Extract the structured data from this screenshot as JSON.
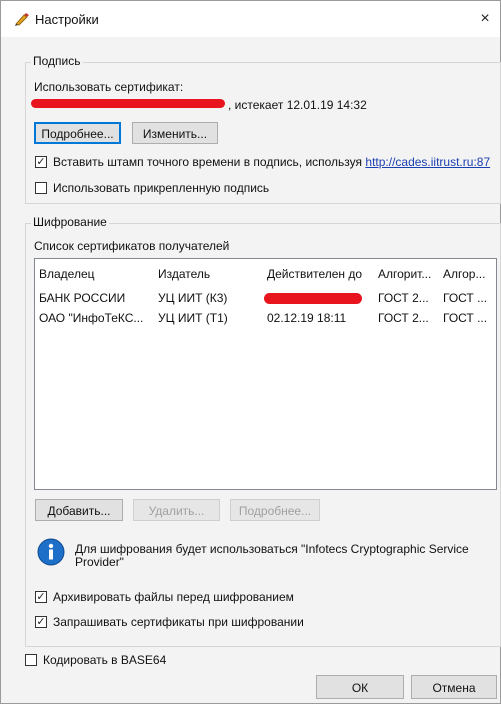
{
  "window": {
    "title": "Настройки",
    "close_glyph": "×"
  },
  "signature": {
    "group_label": "Подпись",
    "use_cert_label": "Использовать сертификат:",
    "cert_expiry": ", истекает 12.01.19 14:32",
    "details_button": "Подробнее...",
    "change_button": "Изменить...",
    "timestamp_checkbox": {
      "checked": true,
      "label": "Вставить штамп точного времени в подпись, используя",
      "link": "http://cades.iitrust.ru:87"
    },
    "attached_sig_checkbox": {
      "checked": false,
      "label": "Использовать прикрепленную подпись"
    }
  },
  "encryption": {
    "group_label": "Шифрование",
    "recipients_label": "Список сертификатов получателей",
    "columns": [
      "Владелец",
      "Издатель",
      "Действителен до",
      "Алгорит...",
      "Алгор..."
    ],
    "rows": [
      {
        "owner": "БАНК РОССИИ",
        "issuer": "УЦ ИИТ (К3)",
        "valid_to": "",
        "alg1": "ГОСТ 2...",
        "alg2": "ГОСТ ..."
      },
      {
        "owner": "ОАО \"ИнфоТеКС...",
        "issuer": "УЦ ИИТ (Т1)",
        "valid_to": "02.12.19 18:11",
        "alg1": "ГОСТ 2...",
        "alg2": "ГОСТ ..."
      }
    ],
    "add_button": "Добавить...",
    "delete_button": "Удалить...",
    "details_button": "Подробнее...",
    "info_text": "Для шифрования будет использоваться \"Infotecs Cryptographic Service Provider\"",
    "archive_checkbox": {
      "checked": true,
      "label": "Архивировать файлы перед шифрованием"
    },
    "ask_certs_checkbox": {
      "checked": true,
      "label": "Запрашивать сертификаты при шифровании"
    }
  },
  "base64_checkbox": {
    "checked": false,
    "label": "Кодировать в BASE64"
  },
  "footer": {
    "ok_button": "ОК",
    "cancel_button": "Отмена"
  },
  "colors": {
    "redaction": "#e8141e",
    "link": "#1a3fb0",
    "focus_border": "#0078d7"
  },
  "icons": {
    "title": "pen-icon",
    "info": "info-icon",
    "close": "close-icon",
    "check": "checkmark-icon"
  }
}
